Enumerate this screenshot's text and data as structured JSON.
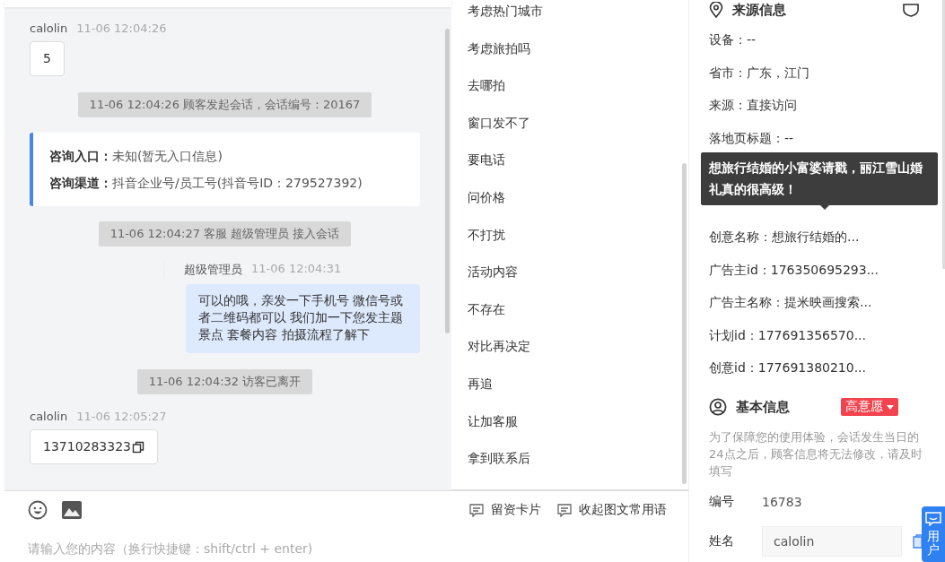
{
  "chat": {
    "messages": [
      {
        "kind": "customer",
        "sender": "calolin",
        "time": "11-06 12:04:26",
        "text": "5"
      },
      {
        "kind": "system",
        "text": "11-06 12:04:26 顾客发起会话，会话编号：20167"
      },
      {
        "kind": "info",
        "lines": [
          {
            "label": "咨询入口：",
            "value": "未知(暂无入口信息)"
          },
          {
            "label": "咨询渠道：",
            "value": "抖音企业号/员工号(抖音号ID：279527392)"
          }
        ]
      },
      {
        "kind": "system",
        "text": "11-06 12:04:27 客服 超级管理员 接入会话"
      },
      {
        "kind": "agent",
        "sender": "超级管理员",
        "time": "11-06 12:04:31",
        "text": "可以的哦，亲发一下手机号 微信号或者二维码都可以 我们加一下您发主题景点 套餐内容 拍摄流程了解下"
      },
      {
        "kind": "system",
        "text": "11-06 12:04:32 访客已离开"
      },
      {
        "kind": "customer",
        "sender": "calolin",
        "time": "11-06 12:05:27",
        "text": "13710283323",
        "copyable": true
      }
    ]
  },
  "phrases": [
    "考虑热门城市",
    "考虑旅拍吗",
    "去哪拍",
    "窗口发不了",
    "要电话",
    "问价格",
    "不打扰",
    "活动内容",
    "不存在",
    "对比再决定",
    "再追",
    "让加客服",
    "拿到联系后"
  ],
  "compose": {
    "buttons": [
      "留资卡片",
      "收起图文常用语"
    ],
    "placeholder": "请输入您的内容（换行快捷键：shift/ctrl + enter)"
  },
  "source_info": {
    "title": "来源信息",
    "rows_before": [
      "设备：--",
      "省市：广东，江门",
      "来源：直接访问",
      "落地页标题：--"
    ],
    "tooltip": "想旅行结婚的小富婆请戳，丽江雪山婚礼真的很高级！",
    "rows_after": [
      "创意名称：想旅行结婚的...",
      "广告主id：176350695293...",
      "广告主名称：提米映画搜索...",
      "计划id：177691356570...",
      "创意id：177691380210..."
    ]
  },
  "basic_info": {
    "title": "基本信息",
    "intent_badge": "高意愿",
    "notice": "为了保障您的使用体验，会话发生当日的24点之后，顾客信息将无法修改，请及时填写",
    "fields": [
      {
        "kind": "text",
        "label": "编号",
        "value": "16783"
      },
      {
        "kind": "input",
        "label": "姓名",
        "value": "calolin"
      }
    ]
  },
  "side_tab": {
    "label": "用户"
  }
}
